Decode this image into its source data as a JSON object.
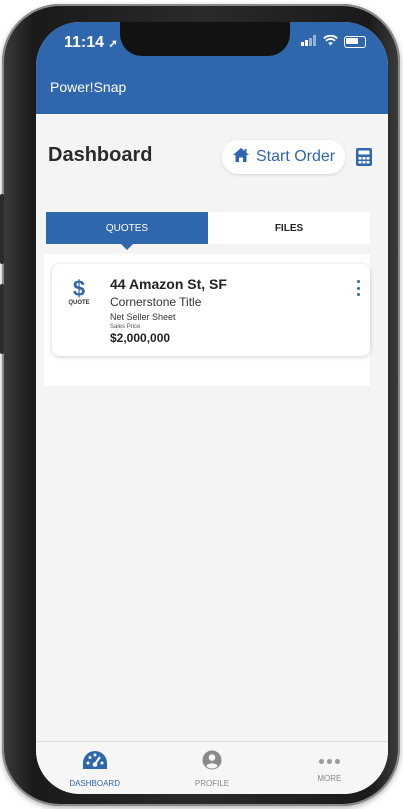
{
  "status_bar": {
    "time": "11:14",
    "signal": "..l"
  },
  "app": {
    "title": "Power!Snap"
  },
  "dashboard": {
    "title": "Dashboard",
    "start_order_label": "Start Order",
    "tabs": [
      {
        "label": "QUOTES",
        "active": true
      },
      {
        "label": "FILES",
        "active": false
      }
    ],
    "quotes": [
      {
        "icon_symbol": "$",
        "icon_label": "QUOTE",
        "address": "44 Amazon St, SF",
        "company": "Cornerstone Title",
        "sheet_type": "Net Seller Sheet",
        "price_label": "Sales Price",
        "price": "$2,000,000"
      }
    ]
  },
  "bottom_nav": [
    {
      "label": "DASHBOARD",
      "icon": "speedometer-icon",
      "active": true
    },
    {
      "label": "PROFILE",
      "icon": "user-icon",
      "active": false
    },
    {
      "label": "MORE",
      "icon": "more-icon",
      "active": false
    }
  ],
  "colors": {
    "brand": "#2f67ad",
    "background": "#f4f4f4",
    "inactive": "#9a9a9a"
  }
}
